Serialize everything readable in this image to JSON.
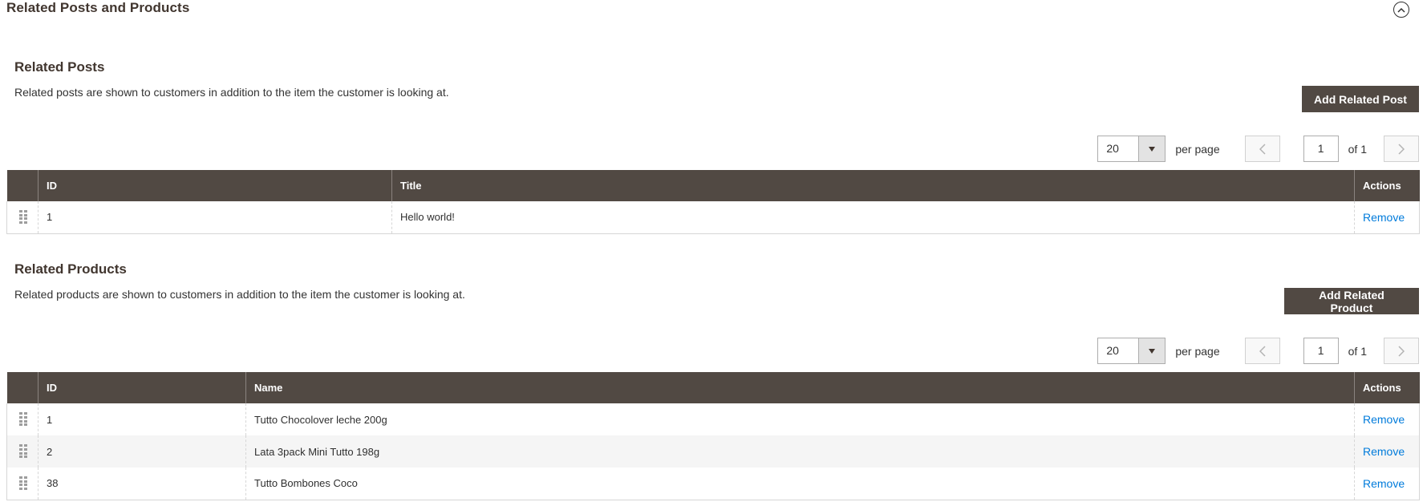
{
  "section": {
    "title": "Related Posts and Products"
  },
  "related_posts": {
    "title": "Related Posts",
    "description": "Related posts are shown to customers in addition to the item the customer is looking at.",
    "add_button": "Add Related Post",
    "pager": {
      "per_page_value": "20",
      "per_page_label": "per page",
      "current_page": "1",
      "of_label": "of 1"
    },
    "columns": {
      "id": "ID",
      "title": "Title",
      "actions": "Actions"
    },
    "rows": [
      {
        "id": "1",
        "title": "Hello world!",
        "action": "Remove"
      }
    ]
  },
  "related_products": {
    "title": "Related Products",
    "description": "Related products are shown to customers in addition to the item the customer is looking at.",
    "add_button": "Add Related Product",
    "pager": {
      "per_page_value": "20",
      "per_page_label": "per page",
      "current_page": "1",
      "of_label": "of 1"
    },
    "columns": {
      "id": "ID",
      "name": "Name",
      "actions": "Actions"
    },
    "rows": [
      {
        "id": "1",
        "name": "Tutto Chocolover leche 200g",
        "action": "Remove"
      },
      {
        "id": "2",
        "name": "Lata 3pack Mini Tutto 198g",
        "action": "Remove"
      },
      {
        "id": "38",
        "name": "Tutto Bombones Coco",
        "action": "Remove"
      }
    ]
  },
  "icons": {
    "collapse": "chevron-up-circle-icon",
    "prev": "chevron-left-icon",
    "next": "chevron-right-icon",
    "drag": "drag-handle-icon"
  },
  "colors": {
    "header_bg": "#514943",
    "link": "#007bdb",
    "title": "#41362f"
  }
}
